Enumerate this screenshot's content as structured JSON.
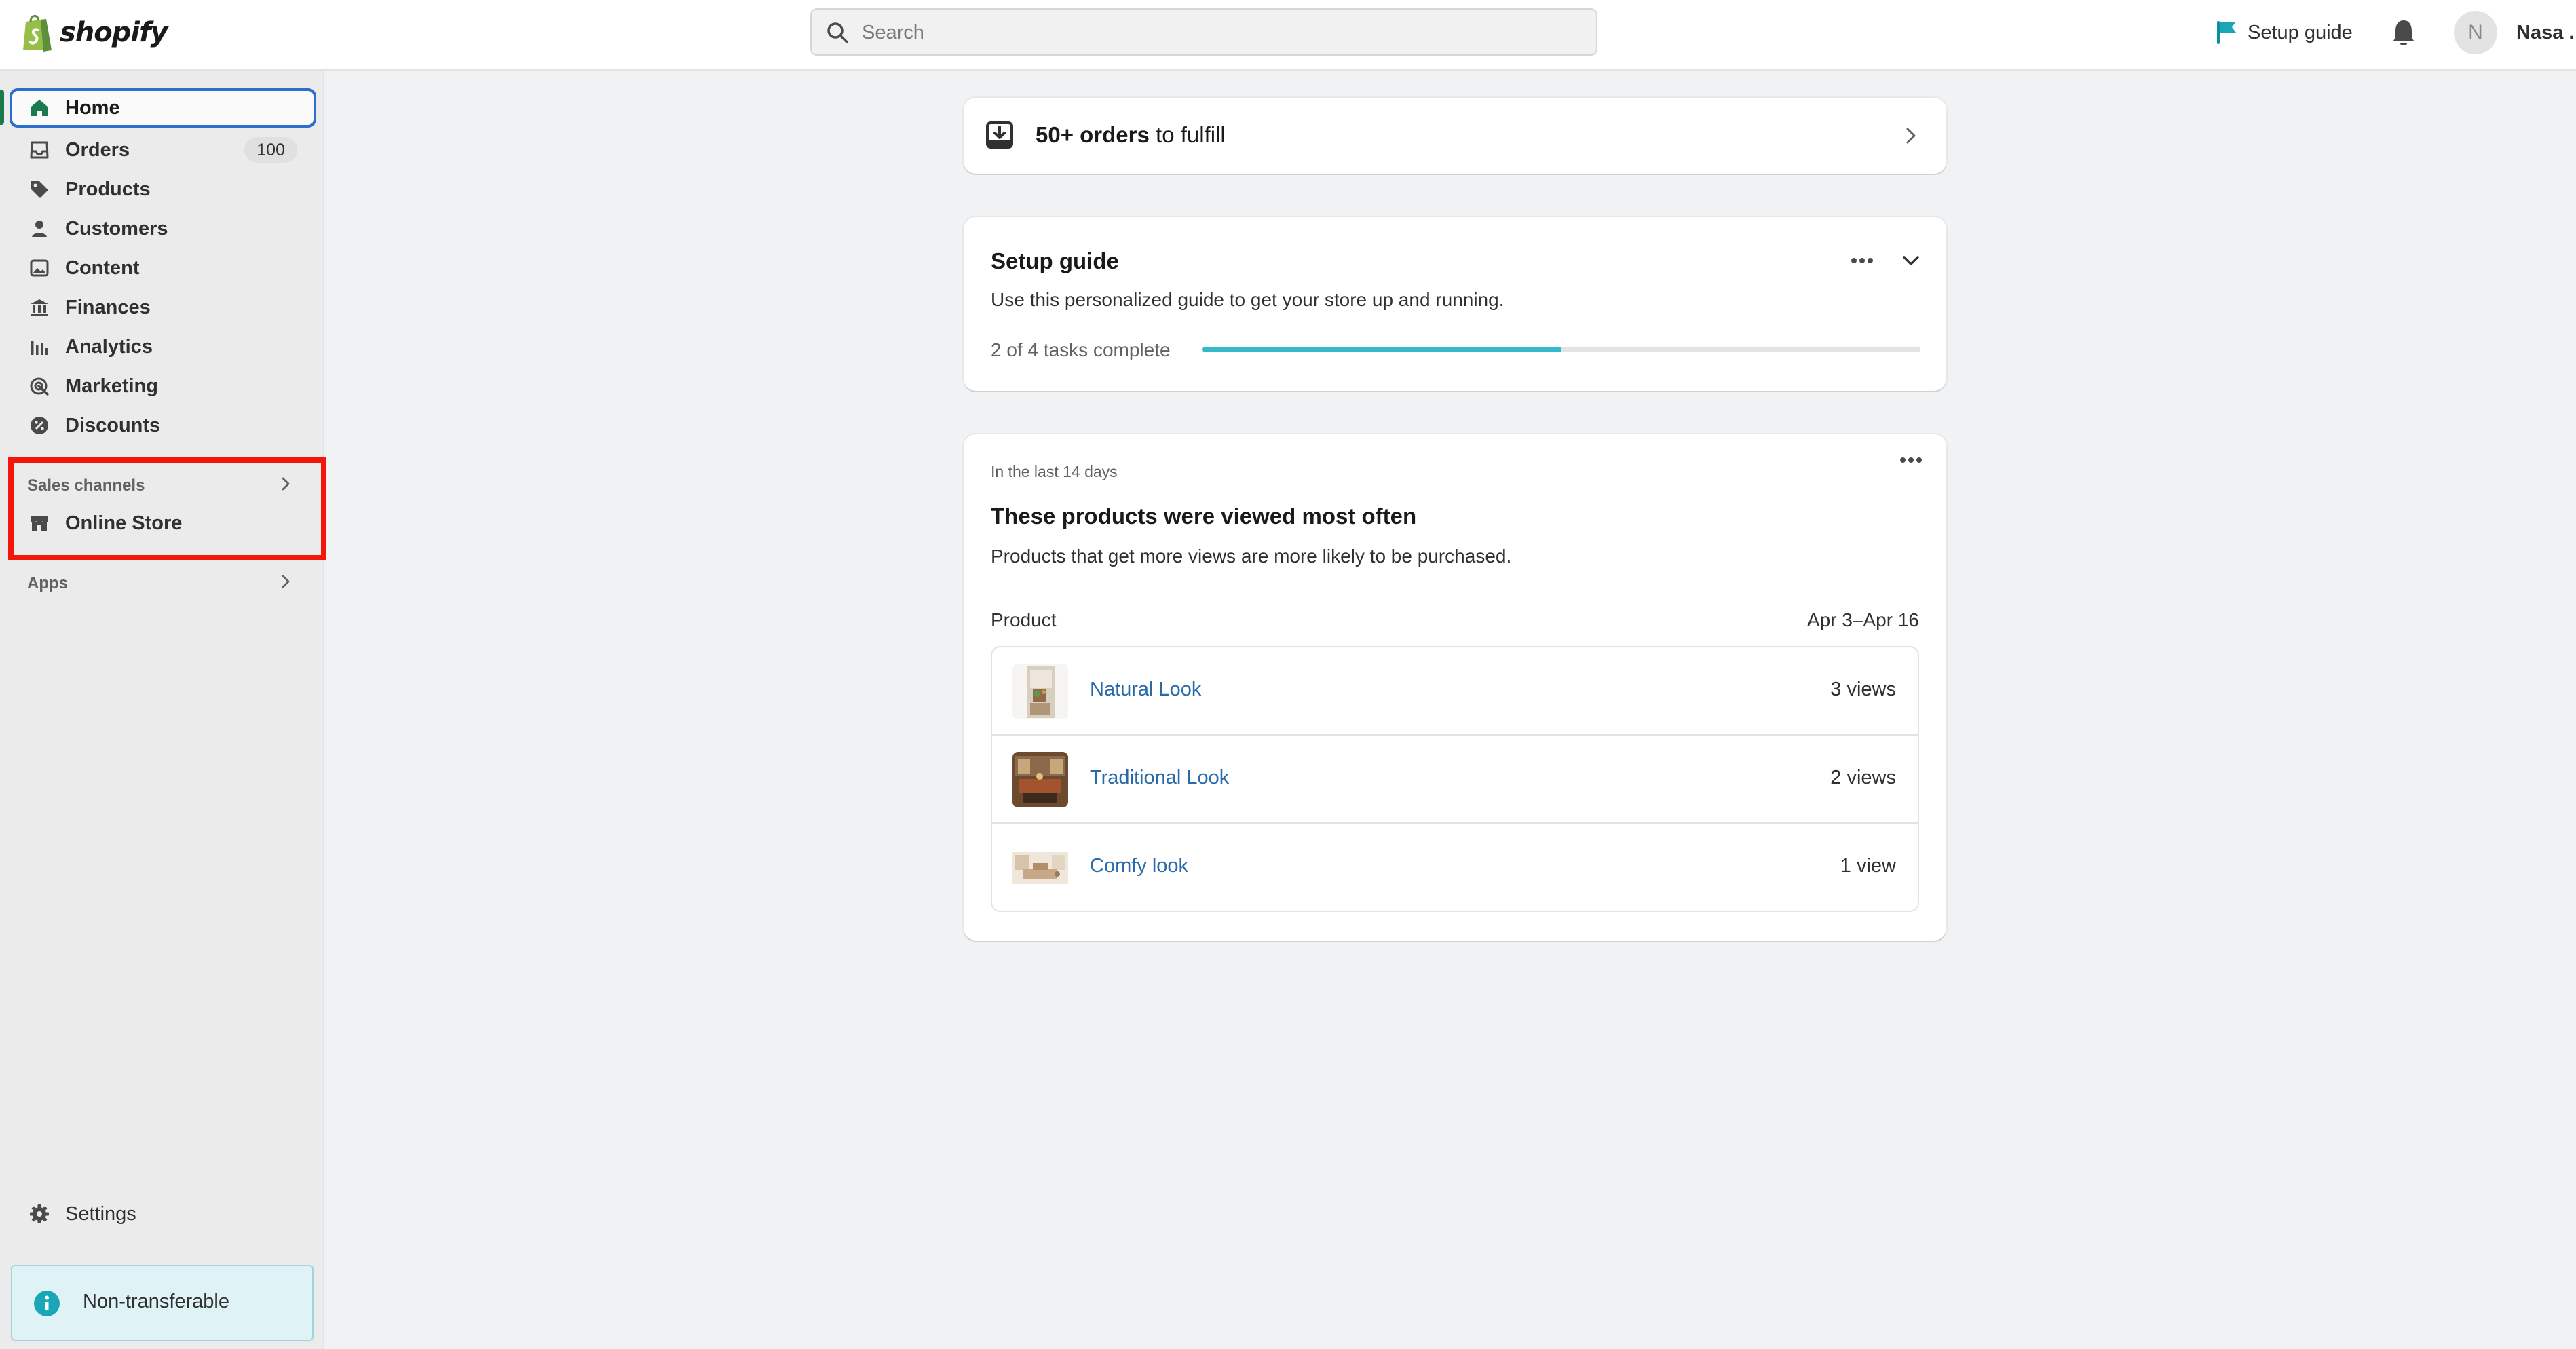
{
  "brand": {
    "name": "shopify",
    "accent": "#1b7a4d",
    "link_color": "#2a6aa8",
    "progress_color": "#36b8cb",
    "highlight_color": "#f3160b"
  },
  "topbar": {
    "search": {
      "placeholder": "Search",
      "icon": "search-icon"
    },
    "setup_guide_label": "Setup guide",
    "user": {
      "initial": "N",
      "name": "Nasa ."
    }
  },
  "sidebar": {
    "items": [
      {
        "label": "Home",
        "icon": "home-icon",
        "active": true
      },
      {
        "label": "Orders",
        "icon": "inbox-icon",
        "badge": "100"
      },
      {
        "label": "Products",
        "icon": "tag-icon"
      },
      {
        "label": "Customers",
        "icon": "person-icon"
      },
      {
        "label": "Content",
        "icon": "image-icon"
      },
      {
        "label": "Finances",
        "icon": "bank-icon"
      },
      {
        "label": "Analytics",
        "icon": "bar-chart-icon"
      },
      {
        "label": "Marketing",
        "icon": "target-icon"
      },
      {
        "label": "Discounts",
        "icon": "discount-icon"
      }
    ],
    "sales_channels": {
      "heading": "Sales channels",
      "items": [
        {
          "label": "Online Store",
          "icon": "store-icon"
        }
      ]
    },
    "apps_heading": "Apps",
    "settings_label": "Settings",
    "notice": "Non-transferable"
  },
  "main": {
    "orders_card": {
      "count": "50+ orders",
      "suffix": " to fulfill"
    },
    "setup_guide": {
      "title": "Setup guide",
      "description": "Use this personalized guide to get your store up and running.",
      "progress_label": "2 of 4 tasks complete",
      "completed": 2,
      "total": 4
    },
    "most_viewed": {
      "kicker": "In the last 14 days",
      "title": "These products were viewed most often",
      "description": "Products that get more views are more likely to be purchased.",
      "column_product": "Product",
      "column_range": "Apr 3–Apr 16",
      "rows": [
        {
          "name": "Natural Look",
          "views": "3 views"
        },
        {
          "name": "Traditional Look",
          "views": "2 views"
        },
        {
          "name": "Comfy look",
          "views": "1 view"
        }
      ]
    }
  }
}
